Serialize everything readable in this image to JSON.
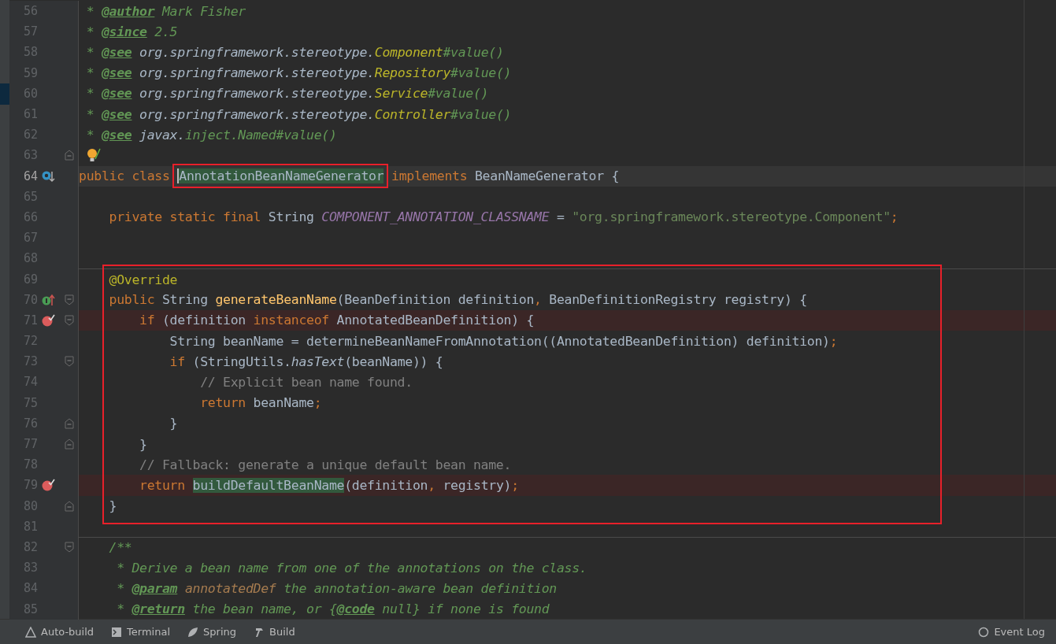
{
  "editor": {
    "lines": [
      {
        "number": "56",
        "tokens": [
          {
            "kind": "doc",
            "text": " * "
          },
          {
            "kind": "doctag",
            "text": "@author"
          },
          {
            "kind": "doc",
            "text": " Mark Fisher"
          }
        ]
      },
      {
        "number": "57",
        "tokens": [
          {
            "kind": "doc",
            "text": " * "
          },
          {
            "kind": "doctag",
            "text": "@since"
          },
          {
            "kind": "doc",
            "text": " 2.5"
          }
        ]
      },
      {
        "number": "58",
        "tokens": [
          {
            "kind": "doc",
            "text": " * "
          },
          {
            "kind": "doctag",
            "text": "@see"
          },
          {
            "kind": "docref",
            "text": " org.springframework.stereotype."
          },
          {
            "kind": "docclass",
            "text": "Component"
          },
          {
            "kind": "doc",
            "text": "#value()"
          }
        ]
      },
      {
        "number": "59",
        "tokens": [
          {
            "kind": "doc",
            "text": " * "
          },
          {
            "kind": "doctag",
            "text": "@see"
          },
          {
            "kind": "docref",
            "text": " org.springframework.stereotype."
          },
          {
            "kind": "docclass",
            "text": "Repository"
          },
          {
            "kind": "doc",
            "text": "#value()"
          }
        ]
      },
      {
        "number": "60",
        "tokens": [
          {
            "kind": "doc",
            "text": " * "
          },
          {
            "kind": "doctag",
            "text": "@see"
          },
          {
            "kind": "docref",
            "text": " org.springframework.stereotype."
          },
          {
            "kind": "docclass",
            "text": "Service"
          },
          {
            "kind": "doc",
            "text": "#value()"
          }
        ]
      },
      {
        "number": "61",
        "tokens": [
          {
            "kind": "doc",
            "text": " * "
          },
          {
            "kind": "doctag",
            "text": "@see"
          },
          {
            "kind": "docref",
            "text": " org.springframework.stereotype."
          },
          {
            "kind": "docclass",
            "text": "Controller"
          },
          {
            "kind": "doc",
            "text": "#value()"
          }
        ]
      },
      {
        "number": "62",
        "tokens": [
          {
            "kind": "doc",
            "text": " * "
          },
          {
            "kind": "doctag",
            "text": "@see"
          },
          {
            "kind": "docref",
            "text": " javax."
          },
          {
            "kind": "doc",
            "text": "inject.Named#value()"
          }
        ]
      },
      {
        "number": "63",
        "fold_end": true,
        "bulb": true
      },
      {
        "number": "64",
        "current": true,
        "implemented": true,
        "tokens": [
          {
            "kind": "kw",
            "text": "public class "
          },
          {
            "kind": "plain",
            "text": "AnnotationBeanNameGenerator",
            "highlighted": true,
            "framed": true
          },
          {
            "kind": "kw",
            "text": " implements "
          },
          {
            "kind": "plain",
            "text": "BeanNameGenerator {"
          }
        ]
      },
      {
        "number": "65"
      },
      {
        "number": "66",
        "tokens": [
          {
            "kind": "kw",
            "text": "    private static final "
          },
          {
            "kind": "plain",
            "text": "String "
          },
          {
            "kind": "const",
            "text": "COMPONENT_ANNOTATION_CLASSNAME"
          },
          {
            "kind": "plain",
            "text": " = "
          },
          {
            "kind": "string",
            "text": "\"org.springframework.stereotype.Component\""
          },
          {
            "kind": "punct",
            "text": ";"
          }
        ]
      },
      {
        "number": "67"
      },
      {
        "number": "68"
      },
      {
        "number": "69",
        "separator": true,
        "framed": true,
        "tokens": [
          {
            "kind": "annotation",
            "text": "    @Override"
          }
        ]
      },
      {
        "number": "70",
        "fold_start": true,
        "overrides": true,
        "framed": true,
        "tokens": [
          {
            "kind": "kw",
            "text": "    public "
          },
          {
            "kind": "plain",
            "text": "String "
          },
          {
            "kind": "decl",
            "text": "generateBeanName"
          },
          {
            "kind": "plain",
            "text": "(BeanDefinition definition"
          },
          {
            "kind": "punct",
            "text": ","
          },
          {
            "kind": "plain",
            "text": " BeanDefinitionRegistry registry) {"
          }
        ]
      },
      {
        "number": "71",
        "fold_start": true,
        "breakpoint": true,
        "framed": true,
        "tokens": [
          {
            "kind": "kw",
            "text": "        if "
          },
          {
            "kind": "plain",
            "text": "(definition "
          },
          {
            "kind": "kw",
            "text": "instanceof "
          },
          {
            "kind": "plain",
            "text": "AnnotatedBeanDefinition) {"
          }
        ]
      },
      {
        "number": "72",
        "framed": true,
        "tokens": [
          {
            "kind": "plain",
            "text": "            String beanName = determineBeanNameFromAnnotation((AnnotatedBeanDefinition) definition)"
          },
          {
            "kind": "punct",
            "text": ";"
          }
        ]
      },
      {
        "number": "73",
        "fold_start": true,
        "framed": true,
        "tokens": [
          {
            "kind": "kw",
            "text": "            if "
          },
          {
            "kind": "plain",
            "text": "(StringUtils."
          },
          {
            "kind": "static",
            "text": "hasText"
          },
          {
            "kind": "plain",
            "text": "(beanName)) {"
          }
        ]
      },
      {
        "number": "74",
        "framed": true,
        "tokens": [
          {
            "kind": "comment",
            "text": "                // Explicit bean name found."
          }
        ]
      },
      {
        "number": "75",
        "framed": true,
        "tokens": [
          {
            "kind": "kw",
            "text": "                return "
          },
          {
            "kind": "plain",
            "text": "beanName"
          },
          {
            "kind": "punct",
            "text": ";"
          }
        ]
      },
      {
        "number": "76",
        "fold_end": true,
        "framed": true,
        "tokens": [
          {
            "kind": "plain",
            "text": "            }"
          }
        ]
      },
      {
        "number": "77",
        "fold_end": true,
        "framed": true,
        "tokens": [
          {
            "kind": "plain",
            "text": "        }"
          }
        ]
      },
      {
        "number": "78",
        "framed": true,
        "tokens": [
          {
            "kind": "comment",
            "text": "        // Fallback: generate a unique default bean name."
          }
        ]
      },
      {
        "number": "79",
        "breakpoint": true,
        "framed": true,
        "tokens": [
          {
            "kind": "kw",
            "text": "        return "
          },
          {
            "kind": "plain",
            "text": "buildDefaultBeanName",
            "highlighted": true
          },
          {
            "kind": "plain",
            "text": "(definition"
          },
          {
            "kind": "punct",
            "text": ","
          },
          {
            "kind": "plain",
            "text": " registry)"
          },
          {
            "kind": "punct",
            "text": ";"
          }
        ]
      },
      {
        "number": "80",
        "fold_end": true,
        "framed": true,
        "tokens": [
          {
            "kind": "plain",
            "text": "    }"
          }
        ]
      },
      {
        "number": "81"
      },
      {
        "number": "82",
        "fold_start": true,
        "separator": true,
        "tokens": [
          {
            "kind": "doc",
            "text": "    /**"
          }
        ]
      },
      {
        "number": "83",
        "tokens": [
          {
            "kind": "doc",
            "text": "     * Derive a bean name from one of the annotations on the class."
          }
        ]
      },
      {
        "number": "84",
        "tokens": [
          {
            "kind": "doc",
            "text": "     * "
          },
          {
            "kind": "doctag",
            "text": "@param"
          },
          {
            "kind": "docparam",
            "text": " annotatedDef"
          },
          {
            "kind": "doc",
            "text": " the annotation-aware bean definition"
          }
        ]
      },
      {
        "number": "85",
        "tokens": [
          {
            "kind": "doc",
            "text": "     * "
          },
          {
            "kind": "doctag",
            "text": "@return"
          },
          {
            "kind": "doc",
            "text": " the bean name, or {"
          },
          {
            "kind": "doctag",
            "text": "@code"
          },
          {
            "kind": "doc",
            "text": " null} if none is found"
          }
        ]
      }
    ]
  },
  "status_bar": {
    "left_items": [
      {
        "kind": "warning",
        "label": "Auto-build"
      },
      {
        "kind": "terminal",
        "label": "Terminal"
      },
      {
        "kind": "leaf",
        "label": "Spring"
      },
      {
        "kind": "hammer",
        "label": "Build"
      }
    ],
    "right_items": [
      {
        "kind": "circle",
        "label": "Event Log"
      }
    ]
  }
}
